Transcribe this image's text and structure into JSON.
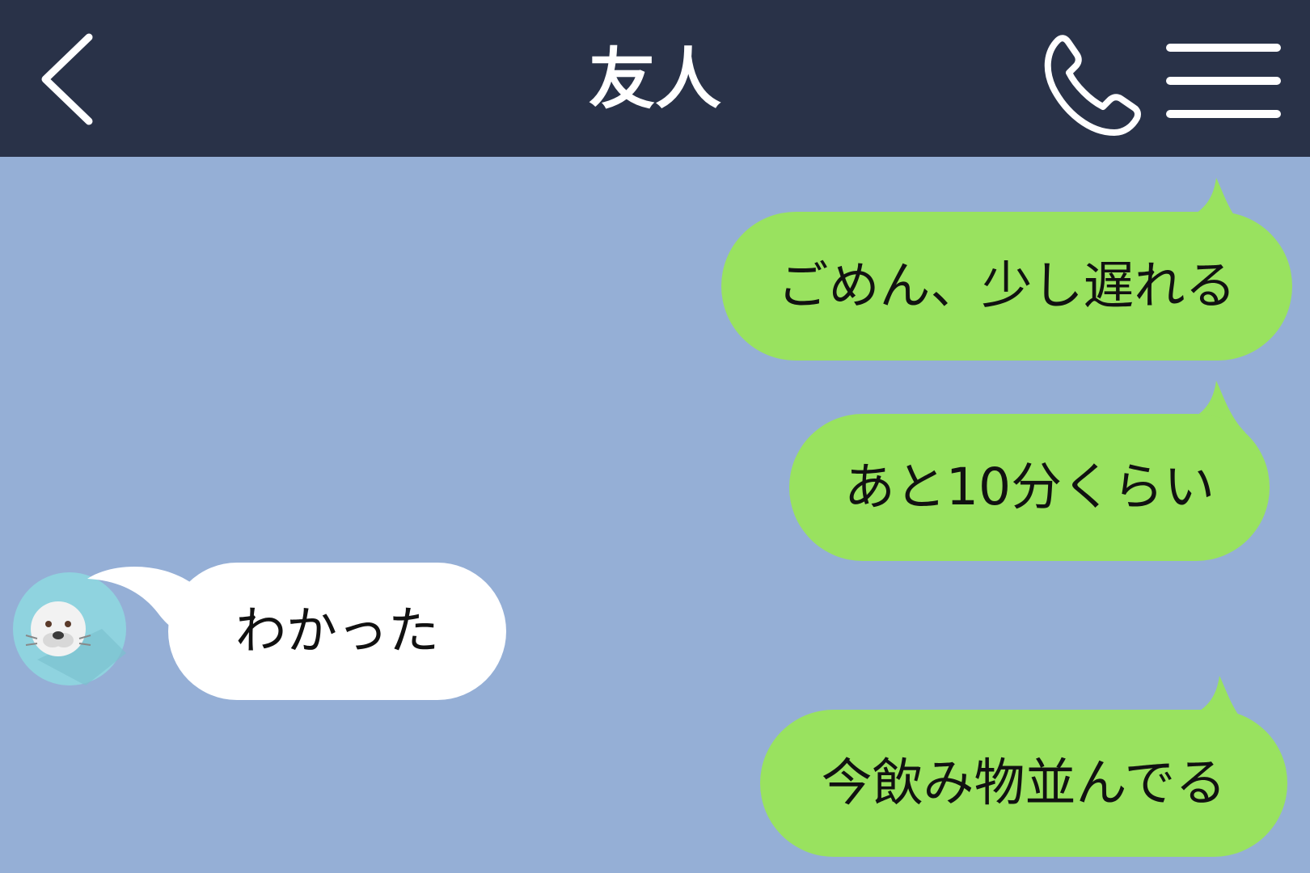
{
  "header": {
    "title": "友人",
    "back_icon": "chevron-left-icon",
    "call_icon": "phone-icon",
    "menu_icon": "hamburger-menu-icon"
  },
  "messages": [
    {
      "sender": "me",
      "text": "ごめん、少し遅れる"
    },
    {
      "sender": "me",
      "text": "あと10分くらい"
    },
    {
      "sender": "friend",
      "text": "わかった",
      "avatar_icon": "seal-avatar-icon"
    },
    {
      "sender": "me",
      "text": "今飲み物並んでる"
    }
  ],
  "colors": {
    "header_bg": "#293248",
    "chat_bg": "#95afd6",
    "sent_bubble": "#99e25f",
    "received_bubble": "#ffffff",
    "avatar_bg": "#8fd3df"
  }
}
